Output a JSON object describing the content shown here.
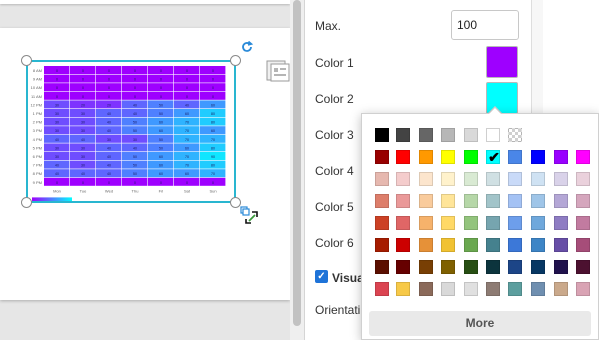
{
  "properties": {
    "max_label": "Max.",
    "max_value": "100",
    "color1_label": "Color 1",
    "color1_value": "#9e00ff",
    "color2_label": "Color 2",
    "color2_value": "#00ffff",
    "color3_label": "Color 3",
    "color4_label": "Color 4",
    "color5_label": "Color 5",
    "color6_label": "Color 6",
    "visual_label": "Visua",
    "visual_checked": true,
    "orientation_label": "Orientati"
  },
  "color_picker": {
    "more_label": "More",
    "selected": "#00ffff",
    "rows": [
      [
        "#000000",
        "#434343",
        "#666666",
        "#b7b7b7",
        "#d9d9d9",
        "#ffffff",
        "transparent"
      ],
      [
        "#980000",
        "#ff0000",
        "#ff9900",
        "#ffff00",
        "#00ff00",
        "#00ffff",
        "#4a86e8",
        "#0000ff",
        "#9900ff",
        "#ff00ff"
      ],
      [
        "#e6b8af",
        "#f4cccc",
        "#fce5cd",
        "#fff2cc",
        "#d9ead3",
        "#d0e0e3",
        "#c9daf8",
        "#cfe2f3",
        "#d9d2e9",
        "#ead1dc"
      ],
      [
        "#dd7e6b",
        "#ea9999",
        "#f9cb9c",
        "#ffe599",
        "#b6d7a8",
        "#a2c4c9",
        "#a4c2f4",
        "#9fc5e8",
        "#b4a7d6",
        "#d5a6bd"
      ],
      [
        "#cc4125",
        "#e06666",
        "#f6b26b",
        "#ffd966",
        "#93c47d",
        "#76a5af",
        "#6d9eeb",
        "#6fa8dc",
        "#8e7cc3",
        "#c27ba0"
      ],
      [
        "#a61c00",
        "#cc0000",
        "#e69138",
        "#f1c232",
        "#6aa84f",
        "#45818e",
        "#3c78d8",
        "#3d85c6",
        "#674ea7",
        "#a64d79"
      ],
      [
        "#5b0f00",
        "#660000",
        "#783f04",
        "#7f6000",
        "#274e13",
        "#0c343d",
        "#1c4587",
        "#073763",
        "#20124d",
        "#4c1130"
      ],
      [
        "#db4451",
        "#f7c948",
        "#8b6a5a",
        "#d9d9d9",
        "#e0e0e0",
        "#8d7b73",
        "#5c9e9e",
        "#6f8fb0",
        "#caa98b",
        "#d9a3b4"
      ]
    ]
  },
  "heatmap": {
    "row_labels": [
      "8 AM",
      "9 AM",
      "10 AM",
      "11 AM",
      "12 PM",
      "1 PM",
      "2 PM",
      "3 PM",
      "4 PM",
      "5 PM",
      "6 PM",
      "7 PM",
      "8 PM",
      "9 PM"
    ],
    "col_labels": [
      "Mon",
      "Tue",
      "Wed",
      "Thu",
      "Fri",
      "Sat",
      "Sun"
    ],
    "values": [
      [
        0,
        0,
        0,
        0,
        0,
        0,
        0
      ],
      [
        0,
        0,
        0,
        0,
        0,
        0,
        0
      ],
      [
        0,
        0,
        0,
        0,
        0,
        0,
        0
      ],
      [
        0,
        0,
        0,
        0,
        0,
        0,
        0
      ],
      [
        30,
        20,
        20,
        40,
        50,
        40,
        60
      ],
      [
        30,
        30,
        40,
        40,
        50,
        60,
        80
      ],
      [
        30,
        30,
        40,
        50,
        60,
        70,
        80
      ],
      [
        30,
        30,
        40,
        50,
        60,
        70,
        60
      ],
      [
        40,
        40,
        30,
        30,
        50,
        70,
        70
      ],
      [
        30,
        30,
        40,
        40,
        50,
        60,
        80
      ],
      [
        30,
        30,
        40,
        50,
        60,
        70,
        90
      ],
      [
        40,
        30,
        40,
        50,
        60,
        70,
        80
      ],
      [
        40,
        40,
        40,
        50,
        60,
        60,
        70
      ],
      [
        0,
        0,
        0,
        0,
        0,
        0,
        0
      ]
    ],
    "color_min": "#9e00ff",
    "color_max": "#00ffff"
  }
}
